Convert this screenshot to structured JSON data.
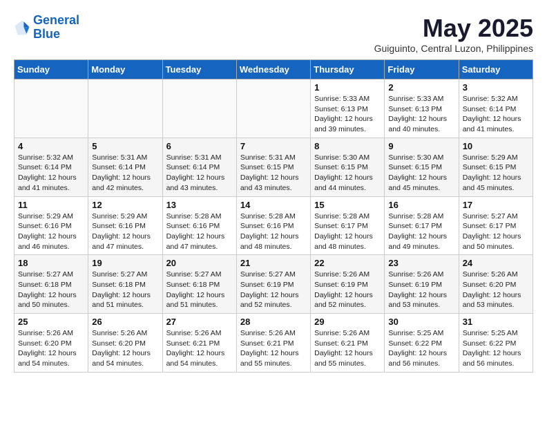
{
  "logo": {
    "line1": "General",
    "line2": "Blue"
  },
  "title": "May 2025",
  "subtitle": "Guiguinto, Central Luzon, Philippines",
  "days_of_week": [
    "Sunday",
    "Monday",
    "Tuesday",
    "Wednesday",
    "Thursday",
    "Friday",
    "Saturday"
  ],
  "weeks": [
    [
      {
        "day": "",
        "info": ""
      },
      {
        "day": "",
        "info": ""
      },
      {
        "day": "",
        "info": ""
      },
      {
        "day": "",
        "info": ""
      },
      {
        "day": "1",
        "info": "Sunrise: 5:33 AM\nSunset: 6:13 PM\nDaylight: 12 hours\nand 39 minutes."
      },
      {
        "day": "2",
        "info": "Sunrise: 5:33 AM\nSunset: 6:13 PM\nDaylight: 12 hours\nand 40 minutes."
      },
      {
        "day": "3",
        "info": "Sunrise: 5:32 AM\nSunset: 6:14 PM\nDaylight: 12 hours\nand 41 minutes."
      }
    ],
    [
      {
        "day": "4",
        "info": "Sunrise: 5:32 AM\nSunset: 6:14 PM\nDaylight: 12 hours\nand 41 minutes."
      },
      {
        "day": "5",
        "info": "Sunrise: 5:31 AM\nSunset: 6:14 PM\nDaylight: 12 hours\nand 42 minutes."
      },
      {
        "day": "6",
        "info": "Sunrise: 5:31 AM\nSunset: 6:14 PM\nDaylight: 12 hours\nand 43 minutes."
      },
      {
        "day": "7",
        "info": "Sunrise: 5:31 AM\nSunset: 6:15 PM\nDaylight: 12 hours\nand 43 minutes."
      },
      {
        "day": "8",
        "info": "Sunrise: 5:30 AM\nSunset: 6:15 PM\nDaylight: 12 hours\nand 44 minutes."
      },
      {
        "day": "9",
        "info": "Sunrise: 5:30 AM\nSunset: 6:15 PM\nDaylight: 12 hours\nand 45 minutes."
      },
      {
        "day": "10",
        "info": "Sunrise: 5:29 AM\nSunset: 6:15 PM\nDaylight: 12 hours\nand 45 minutes."
      }
    ],
    [
      {
        "day": "11",
        "info": "Sunrise: 5:29 AM\nSunset: 6:16 PM\nDaylight: 12 hours\nand 46 minutes."
      },
      {
        "day": "12",
        "info": "Sunrise: 5:29 AM\nSunset: 6:16 PM\nDaylight: 12 hours\nand 47 minutes."
      },
      {
        "day": "13",
        "info": "Sunrise: 5:28 AM\nSunset: 6:16 PM\nDaylight: 12 hours\nand 47 minutes."
      },
      {
        "day": "14",
        "info": "Sunrise: 5:28 AM\nSunset: 6:16 PM\nDaylight: 12 hours\nand 48 minutes."
      },
      {
        "day": "15",
        "info": "Sunrise: 5:28 AM\nSunset: 6:17 PM\nDaylight: 12 hours\nand 48 minutes."
      },
      {
        "day": "16",
        "info": "Sunrise: 5:28 AM\nSunset: 6:17 PM\nDaylight: 12 hours\nand 49 minutes."
      },
      {
        "day": "17",
        "info": "Sunrise: 5:27 AM\nSunset: 6:17 PM\nDaylight: 12 hours\nand 50 minutes."
      }
    ],
    [
      {
        "day": "18",
        "info": "Sunrise: 5:27 AM\nSunset: 6:18 PM\nDaylight: 12 hours\nand 50 minutes."
      },
      {
        "day": "19",
        "info": "Sunrise: 5:27 AM\nSunset: 6:18 PM\nDaylight: 12 hours\nand 51 minutes."
      },
      {
        "day": "20",
        "info": "Sunrise: 5:27 AM\nSunset: 6:18 PM\nDaylight: 12 hours\nand 51 minutes."
      },
      {
        "day": "21",
        "info": "Sunrise: 5:27 AM\nSunset: 6:19 PM\nDaylight: 12 hours\nand 52 minutes."
      },
      {
        "day": "22",
        "info": "Sunrise: 5:26 AM\nSunset: 6:19 PM\nDaylight: 12 hours\nand 52 minutes."
      },
      {
        "day": "23",
        "info": "Sunrise: 5:26 AM\nSunset: 6:19 PM\nDaylight: 12 hours\nand 53 minutes."
      },
      {
        "day": "24",
        "info": "Sunrise: 5:26 AM\nSunset: 6:20 PM\nDaylight: 12 hours\nand 53 minutes."
      }
    ],
    [
      {
        "day": "25",
        "info": "Sunrise: 5:26 AM\nSunset: 6:20 PM\nDaylight: 12 hours\nand 54 minutes."
      },
      {
        "day": "26",
        "info": "Sunrise: 5:26 AM\nSunset: 6:20 PM\nDaylight: 12 hours\nand 54 minutes."
      },
      {
        "day": "27",
        "info": "Sunrise: 5:26 AM\nSunset: 6:21 PM\nDaylight: 12 hours\nand 54 minutes."
      },
      {
        "day": "28",
        "info": "Sunrise: 5:26 AM\nSunset: 6:21 PM\nDaylight: 12 hours\nand 55 minutes."
      },
      {
        "day": "29",
        "info": "Sunrise: 5:26 AM\nSunset: 6:21 PM\nDaylight: 12 hours\nand 55 minutes."
      },
      {
        "day": "30",
        "info": "Sunrise: 5:25 AM\nSunset: 6:22 PM\nDaylight: 12 hours\nand 56 minutes."
      },
      {
        "day": "31",
        "info": "Sunrise: 5:25 AM\nSunset: 6:22 PM\nDaylight: 12 hours\nand 56 minutes."
      }
    ]
  ]
}
